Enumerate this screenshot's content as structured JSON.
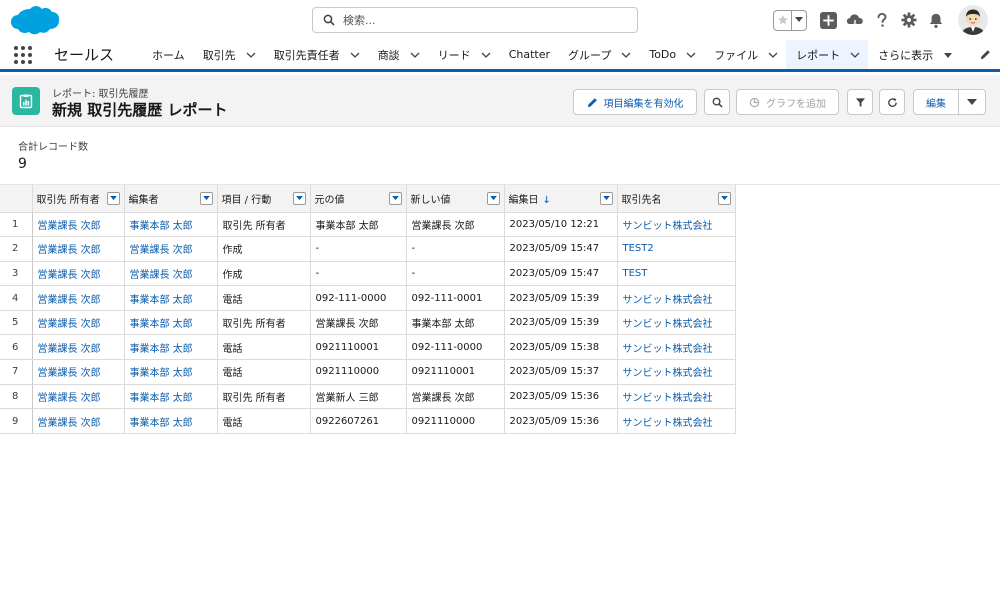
{
  "header": {
    "search_placeholder": "検索..."
  },
  "nav": {
    "app_name": "セールス",
    "items": [
      {
        "label": "ホーム",
        "has_menu": false
      },
      {
        "label": "取引先",
        "has_menu": true
      },
      {
        "label": "取引先責任者",
        "has_menu": true
      },
      {
        "label": "商談",
        "has_menu": true
      },
      {
        "label": "リード",
        "has_menu": true
      },
      {
        "label": "Chatter",
        "has_menu": false
      },
      {
        "label": "グループ",
        "has_menu": true
      },
      {
        "label": "ToDo",
        "has_menu": true
      },
      {
        "label": "ファイル",
        "has_menu": true
      },
      {
        "label": "レポート",
        "has_menu": true,
        "active": true
      },
      {
        "label": "さらに表示",
        "has_menu": true
      }
    ]
  },
  "page": {
    "breadcrumb": "レポート: 取引先履歴",
    "title": "新規 取引先履歴 レポート",
    "buttons": {
      "enable_field_edit": "項目編集を有効化",
      "add_chart": "グラフを追加",
      "edit": "編集"
    }
  },
  "summary": {
    "label": "合計レコード数",
    "value": "9"
  },
  "table": {
    "columns": [
      "取引先 所有者",
      "編集者",
      "項目 / 行動",
      "元の値",
      "新しい値",
      "編集日",
      "取引先名"
    ],
    "rows": [
      [
        "営業課長 次郎",
        "事業本部 太郎",
        "取引先 所有者",
        "事業本部 太郎",
        "営業課長 次郎",
        "2023/05/10 12:21",
        "サンビット株式会社"
      ],
      [
        "営業課長 次郎",
        "営業課長 次郎",
        "作成",
        "-",
        "-",
        "2023/05/09 15:47",
        "TEST2"
      ],
      [
        "営業課長 次郎",
        "営業課長 次郎",
        "作成",
        "-",
        "-",
        "2023/05/09 15:47",
        "TEST"
      ],
      [
        "営業課長 次郎",
        "事業本部 太郎",
        "電話",
        "092-111-0000",
        "092-111-0001",
        "2023/05/09 15:39",
        "サンビット株式会社"
      ],
      [
        "営業課長 次郎",
        "事業本部 太郎",
        "取引先 所有者",
        "営業課長 次郎",
        "事業本部 太郎",
        "2023/05/09 15:39",
        "サンビット株式会社"
      ],
      [
        "営業課長 次郎",
        "事業本部 太郎",
        "電話",
        "0921110001",
        "092-111-0000",
        "2023/05/09 15:38",
        "サンビット株式会社"
      ],
      [
        "営業課長 次郎",
        "事業本部 太郎",
        "電話",
        "0921110000",
        "0921110001",
        "2023/05/09 15:37",
        "サンビット株式会社"
      ],
      [
        "営業課長 次郎",
        "事業本部 太郎",
        "取引先 所有者",
        "営業新人 三郎",
        "営業課長 次郎",
        "2023/05/09 15:36",
        "サンビット株式会社"
      ],
      [
        "営業課長 次郎",
        "事業本部 太郎",
        "電話",
        "0922607261",
        "0921110000",
        "2023/05/09 15:36",
        "サンビット株式会社"
      ]
    ]
  },
  "colors": {
    "brand_blue": "#0b5cab",
    "report_icon": "#2bb8a3",
    "cloud_logo": "#00a1e0"
  }
}
